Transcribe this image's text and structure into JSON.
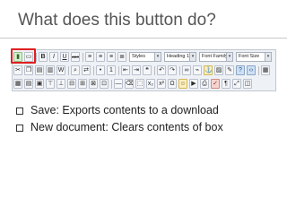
{
  "slide": {
    "title": "What does this button do?",
    "bullets": [
      "Save: Exports contents to a download",
      "New document: Clears contents of box"
    ]
  },
  "toolbar": {
    "styles_select": "Styles",
    "format_select": "Heading 1",
    "font_family_select": "Font Family",
    "font_size_select": "Font Size",
    "bold_glyph": "B",
    "italic_glyph": "I",
    "underline_glyph": "U",
    "strike_glyph": "ABC",
    "caret_glyph": "▾",
    "omega_glyph": "Ω",
    "paragraph_glyph": "¶"
  },
  "colors": {
    "highlight": "#e02020",
    "title": "#555555",
    "toolbar_bg": "#eef1f5"
  }
}
